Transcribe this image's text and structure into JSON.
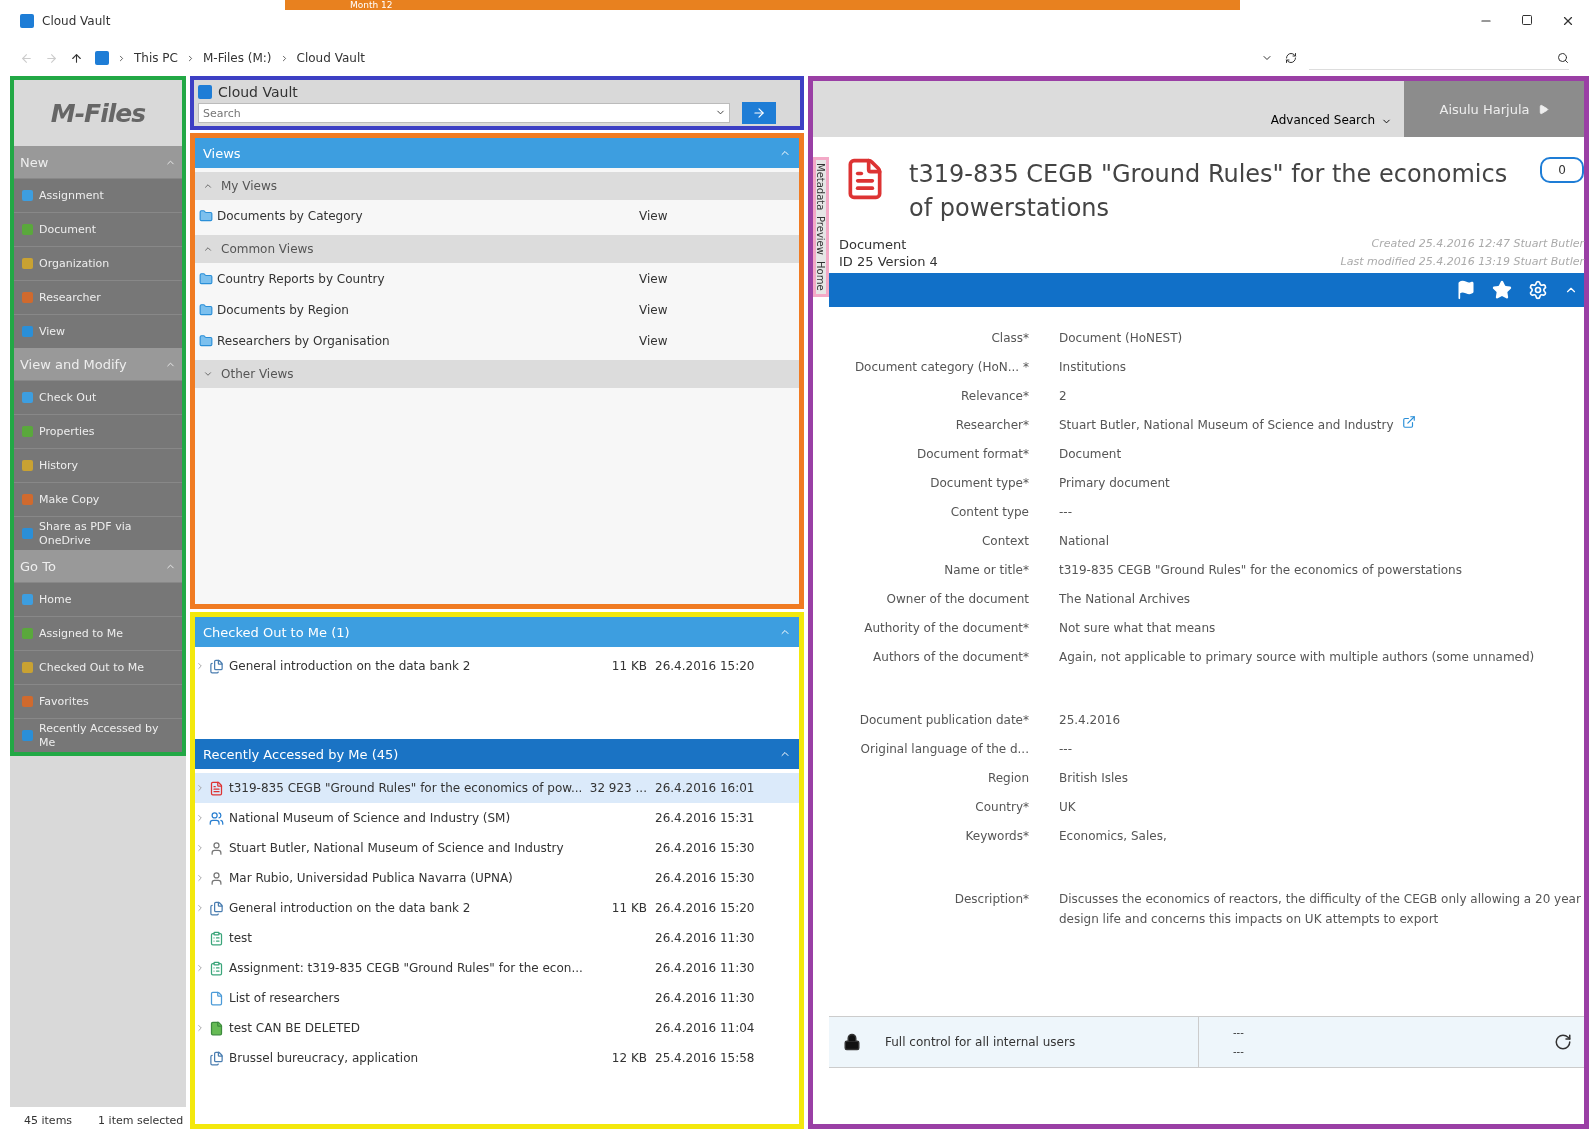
{
  "banner": {
    "text": "Month 12"
  },
  "window": {
    "title": "Cloud Vault"
  },
  "address_bar": {
    "crumbs": [
      "This PC",
      "M-Files (M:)",
      "Cloud Vault"
    ]
  },
  "sidebar": {
    "logo": "M-Files",
    "sections": [
      {
        "title": "New",
        "expanded": true,
        "items": [
          "Assignment",
          "Document",
          "Organization",
          "Researcher",
          "View"
        ]
      },
      {
        "title": "View and Modify",
        "expanded": true,
        "items": [
          "Check Out",
          "Properties",
          "History",
          "Make Copy",
          "Share as PDF via OneDrive"
        ]
      },
      {
        "title": "Go To",
        "expanded": true,
        "items": [
          "Home",
          "Assigned to Me",
          "Checked Out to Me",
          "Favorites",
          "Recently Accessed by Me"
        ]
      }
    ]
  },
  "search": {
    "vault": "Cloud Vault",
    "placeholder": "Search"
  },
  "views": {
    "title": "Views",
    "groups": [
      {
        "title": "My Views",
        "expanded": true,
        "items": [
          {
            "name": "Documents by Category",
            "type": "View"
          }
        ]
      },
      {
        "title": "Common Views",
        "expanded": true,
        "items": [
          {
            "name": "Country Reports by Country",
            "type": "View"
          },
          {
            "name": "Documents by Region",
            "type": "View"
          },
          {
            "name": "Researchers by Organisation",
            "type": "View"
          }
        ]
      },
      {
        "title": "Other Views",
        "expanded": false
      }
    ]
  },
  "checked_out": {
    "title": "Checked Out to Me (1)",
    "rows": [
      {
        "kind": "multi",
        "name": "General introduction on the data bank 2",
        "size": "11 KB",
        "date": "26.4.2016 15:20",
        "expandable": true,
        "selected": false
      }
    ]
  },
  "recent": {
    "title": "Recently Accessed by Me (45)",
    "rows": [
      {
        "kind": "pdf",
        "name": "t319-835 CEGB \"Ground Rules\" for the economics of pow...",
        "size": "32 923 ...",
        "date": "26.4.2016 16:01",
        "expandable": true,
        "selected": true
      },
      {
        "kind": "organization",
        "name": "National Museum of Science and Industry (SM)",
        "size": "",
        "date": "26.4.2016 15:31",
        "expandable": true,
        "selected": false
      },
      {
        "kind": "person",
        "name": "Stuart Butler, National Museum of Science and Industry",
        "size": "",
        "date": "26.4.2016 15:30",
        "expandable": true,
        "selected": false
      },
      {
        "kind": "person",
        "name": "Mar Rubio, Universidad Publica Navarra (UPNA)",
        "size": "",
        "date": "26.4.2016 15:30",
        "expandable": true,
        "selected": false
      },
      {
        "kind": "multi",
        "name": "General introduction on the data bank 2",
        "size": "11 KB",
        "date": "26.4.2016 15:20",
        "expandable": true,
        "selected": false
      },
      {
        "kind": "assignment",
        "name": "test",
        "size": "",
        "date": "26.4.2016 11:30",
        "expandable": false,
        "selected": false
      },
      {
        "kind": "assignment",
        "name": "Assignment: t319-835 CEGB \"Ground Rules\" for the econ...",
        "size": "",
        "date": "26.4.2016 11:30",
        "expandable": true,
        "selected": false
      },
      {
        "kind": "list",
        "name": "List of researchers",
        "size": "",
        "date": "26.4.2016 11:30",
        "expandable": false,
        "selected": false
      },
      {
        "kind": "document",
        "name": "test CAN BE DELETED",
        "size": "",
        "date": "26.4.2016 11:04",
        "expandable": true,
        "selected": false
      },
      {
        "kind": "multi",
        "name": "Brussel bureucracy, application",
        "size": "12 KB",
        "date": "25.4.2016 15:58",
        "expandable": false,
        "selected": false
      }
    ]
  },
  "status_bar": {
    "items": "45 items",
    "selection": "1 item selected"
  },
  "details": {
    "advanced_search": "Advanced Search",
    "user": "Aisulu Harjula",
    "side_tabs": [
      "Metadata",
      "Preview",
      "Home"
    ],
    "title": "t319-835 CEGB \"Ground Rules\" for the economics of powerstations",
    "comments": "0",
    "object_type": "Document",
    "id_line": "ID 25  Version 4",
    "created": "Created 25.4.2016 12:47 Stuart Butler",
    "modified": "Last modified 25.4.2016 13:19 Stuart Butler",
    "property_groups": [
      [
        {
          "label": "Class*",
          "value": "Document (HoNEST)"
        },
        {
          "label": "Document category (HoN... *",
          "value": "Institutions"
        },
        {
          "label": "Relevance*",
          "value": "2"
        },
        {
          "label": "Researcher*",
          "value": "Stuart Butler, National Museum of Science and Industry",
          "link": true
        },
        {
          "label": "Document format*",
          "value": "Document"
        },
        {
          "label": "Document type*",
          "value": "Primary document"
        },
        {
          "label": "Content type",
          "value": "---"
        },
        {
          "label": "Context",
          "value": "National"
        },
        {
          "label": "Name or title*",
          "value": "t319-835 CEGB \"Ground Rules\" for the economics of powerstations"
        },
        {
          "label": "Owner of the document",
          "value": "The National Archives"
        },
        {
          "label": "Authority of the document*",
          "value": "Not sure what that means"
        },
        {
          "label": "Authors of the document*",
          "value": "Again, not applicable to primary source with multiple authors (some unnamed)"
        }
      ],
      [
        {
          "label": "Document publication date*",
          "value": "25.4.2016"
        },
        {
          "label": "Original language of the d...",
          "value": "---"
        },
        {
          "label": "Region",
          "value": "British Isles"
        },
        {
          "label": "Country*",
          "value": "UK"
        },
        {
          "label": "Keywords*",
          "value": "Economics, Sales,"
        }
      ],
      [
        {
          "label": "Description*",
          "value": "Discusses the economics of reactors, the difficulty of the CEGB only allowing a 20 year design life and concerns this impacts on UK attempts to export"
        }
      ]
    ],
    "permissions": "Full control for all internal users",
    "workflow": [
      "---",
      "---"
    ]
  }
}
